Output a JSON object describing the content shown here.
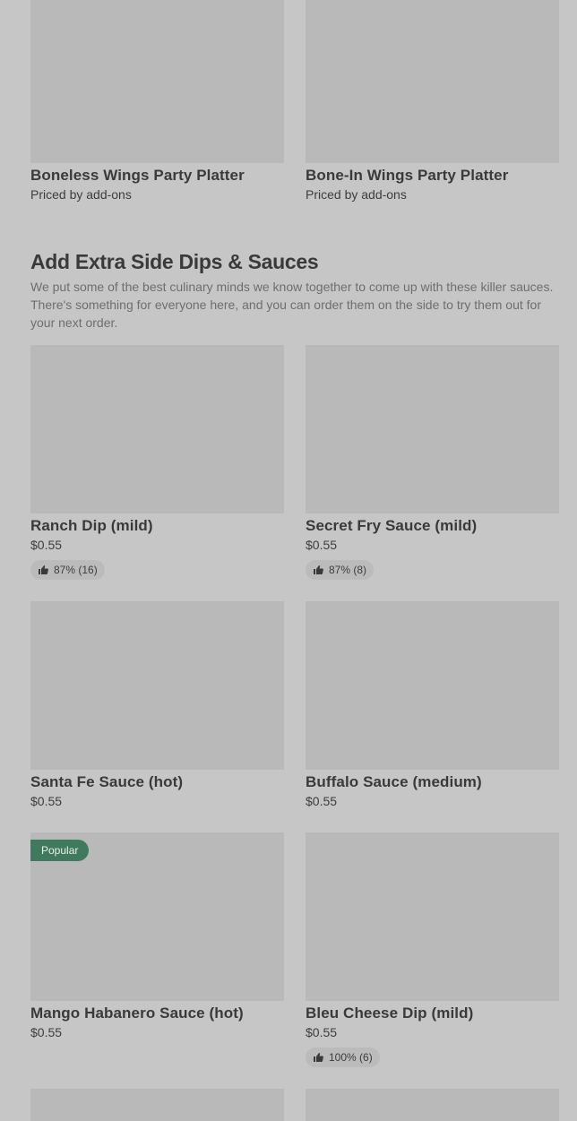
{
  "top_items": [
    {
      "name": "Boneless Wings Party Platter",
      "price": "Priced by add-ons"
    },
    {
      "name": "Bone-In Wings Party Platter",
      "price": "Priced by add-ons"
    }
  ],
  "section": {
    "title": "Add Extra Side Dips & Sauces",
    "description": "We put some of the best culinary minds we know together to come up with these killer sauces. There's something for everyone here, and you can order them on the side to try them out for your next order."
  },
  "items": [
    {
      "name": "Ranch Dip (mild)",
      "price": "$0.55",
      "rating": "87% (16)"
    },
    {
      "name": "Secret Fry Sauce (mild)",
      "price": "$0.55",
      "rating": "87% (8)"
    },
    {
      "name": "Santa Fe Sauce (hot)",
      "price": "$0.55"
    },
    {
      "name": "Buffalo Sauce (medium)",
      "price": "$0.55"
    },
    {
      "name": "Mango Habanero Sauce (hot)",
      "price": "$0.55",
      "badge": "Popular"
    },
    {
      "name": "Bleu Cheese Dip (mild)",
      "price": "$0.55",
      "rating": "100% (6)"
    }
  ],
  "icons": {
    "rating": "thumbs-up-icon"
  }
}
